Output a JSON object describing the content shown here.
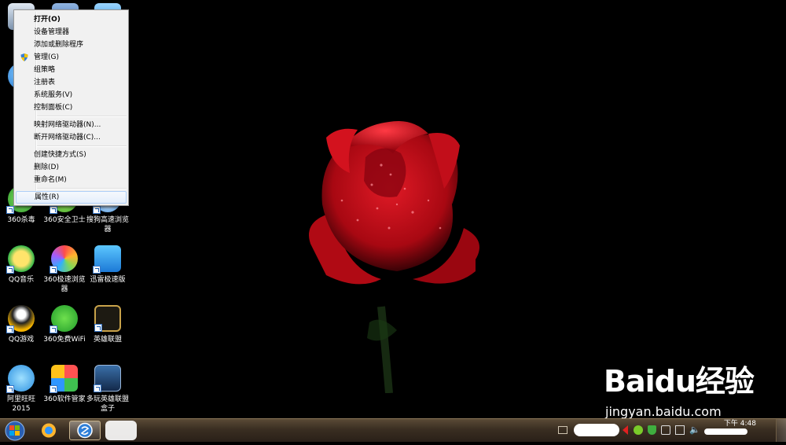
{
  "context_menu": {
    "items": [
      {
        "label": "打开(O)",
        "bold": true
      },
      {
        "label": "设备管理器"
      },
      {
        "label": "添加或删除程序"
      },
      {
        "label": "管理(G)",
        "icon": "uac-shield-icon"
      },
      {
        "label": "组策略"
      },
      {
        "label": "注册表"
      },
      {
        "label": "系统服务(V)"
      },
      {
        "label": "控制面板(C)"
      },
      {
        "label": "映射网络驱动器(N)..."
      },
      {
        "label": "断开网络驱动器(C)..."
      },
      {
        "label": "创建快捷方式(S)"
      },
      {
        "label": "删除(D)"
      },
      {
        "label": "重命名(M)"
      },
      {
        "label": "属性(R)",
        "highlighted": true
      }
    ]
  },
  "desktop_icons": [
    {
      "label": "360杀毒",
      "icon": "360-antivirus-icon"
    },
    {
      "label": "360安全卫士",
      "icon": "360-security-icon"
    },
    {
      "label": "搜狗高速浏览器",
      "icon": "sogou-browser-icon"
    },
    {
      "label": "QQ音乐",
      "icon": "qq-music-icon"
    },
    {
      "label": "360极速浏览器",
      "icon": "360-chrome-icon"
    },
    {
      "label": "迅雷极速版",
      "icon": "xunlei-icon"
    },
    {
      "label": "QQ游戏",
      "icon": "qq-game-icon"
    },
    {
      "label": "360免费WiFi",
      "icon": "360-wifi-icon"
    },
    {
      "label": "英雄联盟",
      "icon": "lol-icon"
    },
    {
      "label": "阿里旺旺2015",
      "icon": "aliwangwang-icon"
    },
    {
      "label": "360软件管家",
      "icon": "360-software-icon"
    },
    {
      "label": "多玩英雄联盟盒子",
      "icon": "duowan-lol-box-icon"
    }
  ],
  "taskbar": {
    "clock_line1": "下午 4:48",
    "clock_line2": ""
  },
  "watermark": {
    "logo_text": "Baidu经验",
    "url": "jingyan.baidu.com"
  },
  "colors": {
    "rose": "#c8101c",
    "menu_bg": "#f1f1f1",
    "taskbar": "#3a2e22"
  }
}
